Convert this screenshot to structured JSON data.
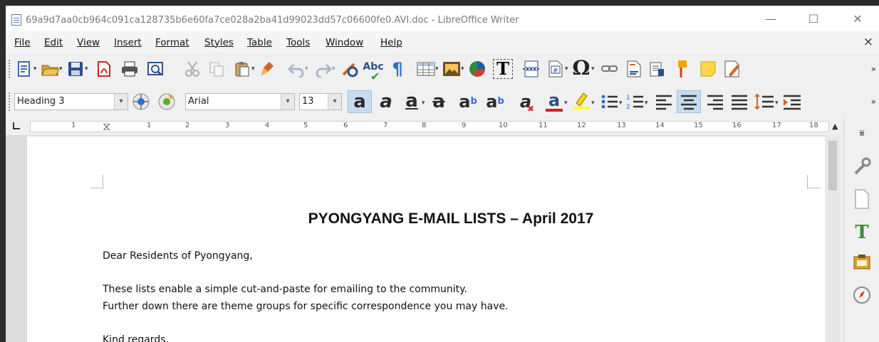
{
  "window": {
    "title": "69a9d7aa0cb964c091ca128735b6e60fa7ce028a2ba41d99023dd57c06600fe0.AVI.doc - LibreOffice Writer",
    "minimize": "—",
    "maximize": "☐",
    "close": "✕"
  },
  "menubar": {
    "items": [
      "File",
      "Edit",
      "View",
      "Insert",
      "Format",
      "Styles",
      "Table",
      "Tools",
      "Window",
      "Help"
    ],
    "close_document": "×"
  },
  "formatting": {
    "paragraph_style": "Heading 3",
    "font_name": "Arial",
    "font_size": "13"
  },
  "ruler": {
    "labels": [
      "1",
      "1",
      "2",
      "3",
      "4",
      "5",
      "6",
      "7",
      "8",
      "9",
      "10",
      "11",
      "12",
      "13",
      "14",
      "15",
      "16",
      "17",
      "18"
    ]
  },
  "document": {
    "title": "PYONGYANG E-MAIL LISTS – April 2017",
    "paragraphs": [
      "Dear Residents of Pyongyang,",
      "These lists enable a simple cut-and-paste for emailing to the community.",
      "Further down there are theme groups for specific correspondence you may have.",
      "Kind regards,"
    ]
  },
  "icons": {
    "toolbar1": [
      "new-document-icon",
      "open-icon",
      "save-icon",
      "export-pdf-icon",
      "print-icon",
      "print-preview-icon",
      "cut-icon",
      "copy-icon",
      "paste-icon",
      "clone-formatting-icon",
      "undo-icon",
      "redo-icon",
      "find-replace-icon",
      "spelling-icon",
      "formatting-marks-icon",
      "insert-table-icon",
      "insert-image-icon",
      "insert-chart-icon",
      "insert-textbox-icon",
      "insert-page-break-icon",
      "insert-field-icon",
      "insert-special-character-icon",
      "insert-hyperlink-icon",
      "insert-footnote-icon",
      "insert-endnote-icon",
      "insert-bookmark-icon",
      "insert-comment-icon",
      "track-changes-icon"
    ],
    "toolbar2": [
      "update-style-icon",
      "new-style-icon",
      "bold-icon",
      "italic-icon",
      "underline-icon",
      "strikethrough-icon",
      "superscript-icon",
      "subscript-icon",
      "clear-formatting-icon",
      "font-color-icon",
      "highlighting-icon",
      "bullets-icon",
      "numbering-icon",
      "align-left-icon",
      "align-center-icon",
      "align-right-icon",
      "justify-icon",
      "line-spacing-icon",
      "increase-indent-icon"
    ],
    "sidebar": [
      "properties-icon",
      "page-icon",
      "styles-icon",
      "gallery-icon",
      "navigator-icon"
    ]
  }
}
